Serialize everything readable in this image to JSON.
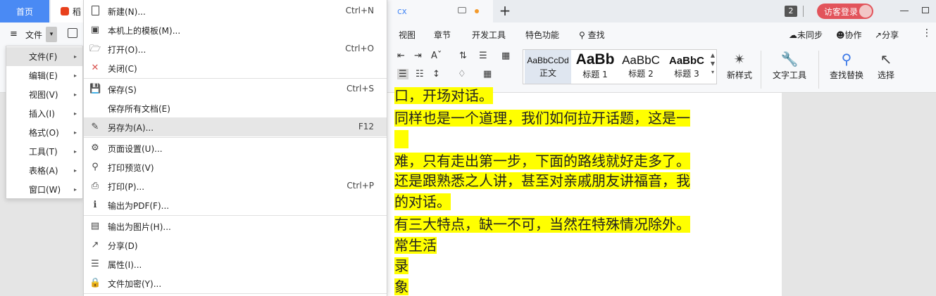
{
  "titlebar": {
    "home_tab": "首页",
    "daoke_tab": "稻",
    "doc_tab": "cx",
    "plus": "+",
    "badge": "2",
    "guest_login": "访客登录"
  },
  "menubar": {
    "hamburger": "≡",
    "file_label": "文件",
    "file_dd": "▾",
    "tabs": [
      "视图",
      "章节",
      "开发工具",
      "特色功能",
      "查找"
    ],
    "unsync": "未同步",
    "collab": "协作",
    "share": "分享",
    "more": "⋮"
  },
  "ribbon": {
    "styles": [
      {
        "preview": "AaBbCcDd",
        "label": "正文"
      },
      {
        "preview": "AaBb",
        "label": "标题 1"
      },
      {
        "preview": "AaBbC",
        "label": "标题 2"
      },
      {
        "preview": "AaBbC",
        "label": "标题 3"
      }
    ],
    "new_style": "新样式",
    "text_tools": "文字工具",
    "find_replace": "查找替换",
    "select": "选择"
  },
  "document": {
    "lines": [
      "口，开场对话。",
      "同样也是一个道理，我们如何拉开话题，这是一",
      "",
      "难，只有走出第一步，下面的路线就好走多了。",
      "还是跟熟悉之人讲，甚至对亲戚朋友讲福音，我",
      "的对话。",
      "有三大特点，缺一不可，当然在特殊情况除外。",
      "常生活",
      "录",
      "象"
    ]
  },
  "left_menu": {
    "items": [
      {
        "label": "文件(F)"
      },
      {
        "label": "编辑(E)"
      },
      {
        "label": "视图(V)"
      },
      {
        "label": "插入(I)"
      },
      {
        "label": "格式(O)"
      },
      {
        "label": "工具(T)"
      },
      {
        "label": "表格(A)"
      },
      {
        "label": "窗口(W)"
      }
    ]
  },
  "file_menu": {
    "items": [
      {
        "label": "新建(N)...",
        "key": "Ctrl+N",
        "icon": "new-doc-icon"
      },
      {
        "label": "本机上的模板(M)...",
        "key": "",
        "icon": "template-icon"
      },
      {
        "label": "打开(O)...",
        "key": "Ctrl+O",
        "icon": "folder-open-icon"
      },
      {
        "label": "关闭(C)",
        "key": "",
        "icon": "close-doc-icon"
      },
      {
        "label": "保存(S)",
        "key": "Ctrl+S",
        "icon": "save-icon"
      },
      {
        "label": "保存所有文档(E)",
        "key": "",
        "icon": ""
      },
      {
        "label": "另存为(A)...",
        "key": "F12",
        "icon": "save-as-icon"
      },
      {
        "label": "页面设置(U)...",
        "key": "",
        "icon": "page-setup-icon"
      },
      {
        "label": "打印预览(V)",
        "key": "",
        "icon": "print-preview-icon"
      },
      {
        "label": "打印(P)...",
        "key": "Ctrl+P",
        "icon": "printer-icon"
      },
      {
        "label": "输出为PDF(F)...",
        "key": "",
        "icon": "pdf-icon"
      },
      {
        "label": "输出为图片(H)...",
        "key": "",
        "icon": "image-export-icon"
      },
      {
        "label": "分享(D)",
        "key": "",
        "icon": "share-icon"
      },
      {
        "label": "属性(I)...",
        "key": "",
        "icon": "properties-icon"
      },
      {
        "label": "文件加密(Y)...",
        "key": "",
        "icon": "encrypt-icon"
      }
    ]
  }
}
